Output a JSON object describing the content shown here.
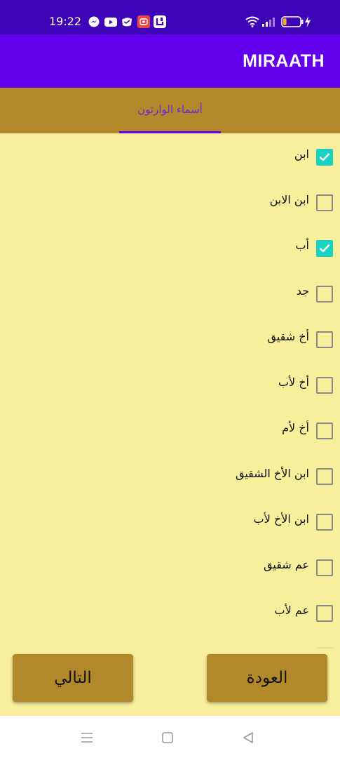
{
  "status_bar": {
    "time": "19:22",
    "left_icons": [
      "messenger-icon",
      "youtube-icon",
      "messenger-lite-icon",
      "screen-record-icon",
      "capcut-icon"
    ],
    "right_icons": [
      "wifi-icon",
      "signal-icon",
      "battery-icon",
      "charging-icon"
    ],
    "battery_level": 0.2
  },
  "app_bar": {
    "title": "MIRAATH",
    "color": "#6200ee"
  },
  "tabs": [
    {
      "label": "أسماء الوارثون",
      "selected": true
    }
  ],
  "heirs": [
    {
      "label": "ابن",
      "checked": true
    },
    {
      "label": "ابن الابن",
      "checked": false
    },
    {
      "label": "أب",
      "checked": true
    },
    {
      "label": "جد",
      "checked": false
    },
    {
      "label": "أخ شقيق",
      "checked": false
    },
    {
      "label": "أخ لأب",
      "checked": false
    },
    {
      "label": "أخ لأم",
      "checked": false
    },
    {
      "label": "ابن الأخ الشقيق",
      "checked": false
    },
    {
      "label": "ابن الأخ لأب",
      "checked": false
    },
    {
      "label": "عم شقيق",
      "checked": false
    },
    {
      "label": "عم لأب",
      "checked": false
    }
  ],
  "buttons": {
    "back_label": "العودة",
    "next_label": "التالي"
  },
  "nav_bar": {
    "icons": [
      "menu-icon",
      "home-icon",
      "back-icon"
    ]
  },
  "colors": {
    "status_bar": "#3e04b8",
    "tab_bar": "#b1882a",
    "background": "#f7ef9c",
    "checkbox_checked": "#1bd1c2"
  }
}
